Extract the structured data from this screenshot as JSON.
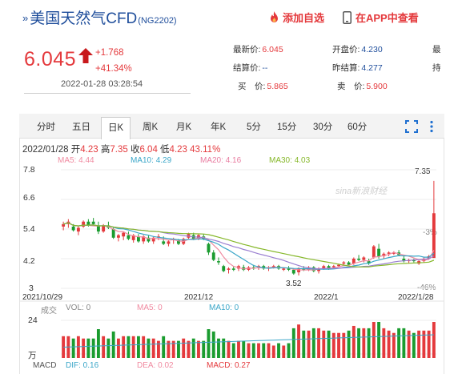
{
  "header": {
    "title": "美国天然气CFD",
    "code": "(NG2202)",
    "favorite_label": "添加自选",
    "app_label": "在APP中查看"
  },
  "quote": {
    "price": "6.045",
    "change": "+1.768",
    "change_pct": "+41.34%",
    "time": "2022-01-28 03:28:54",
    "fields": [
      {
        "label": "最新价:",
        "value": "6.045"
      },
      {
        "label": "结算价:",
        "value": "--"
      },
      {
        "label": "买　价:",
        "value": "5.865"
      },
      {
        "label": "开盘价:",
        "value": "4.230"
      },
      {
        "label": "昨结算:",
        "value": "4.277"
      },
      {
        "label": "卖　价:",
        "value": "5.900"
      },
      {
        "label": "最",
        "value": ""
      },
      {
        "label": "持",
        "value": ""
      }
    ]
  },
  "tabs": [
    "分时",
    "五日",
    "日K",
    "周K",
    "月K",
    "年K",
    "5分",
    "15分",
    "30分",
    "60分"
  ],
  "active_tab": "日K",
  "ohlc_line": {
    "date": "2022/01/28",
    "open_label": "开",
    "open": "4.23",
    "high_label": "高",
    "high": "7.35",
    "close_label": "收",
    "close": "6.04",
    "low_label": "低",
    "low": "4.23",
    "pct": "43.11%"
  },
  "ma_legend": [
    {
      "label": "MA5:",
      "value": "4.44",
      "color": "#f08aa0"
    },
    {
      "label": "MA10:",
      "value": "4.29",
      "color": "#3aa6c8"
    },
    {
      "label": "MA20:",
      "value": "4.16",
      "color": "#e87ca0"
    },
    {
      "label": "MA30:",
      "value": "4.03",
      "color": "#86b82a"
    }
  ],
  "watermark": "sina新浪财经",
  "chart_data": {
    "type": "candlestick",
    "y_ticks": [
      "7.8",
      "6.6",
      "5.4",
      "4.2",
      "3"
    ],
    "right_ticks": [
      "7.35",
      "-3%",
      "-46%"
    ],
    "x_labels": [
      "2021/10/29",
      "2021/12",
      "2022/1",
      "2022/1/28"
    ],
    "high_annotation": "7.35",
    "low_annotation": "3.52",
    "ylim": [
      3,
      7.8
    ],
    "candles": [
      [
        5.5,
        5.7,
        5.35,
        5.6
      ],
      [
        5.6,
        5.8,
        5.45,
        5.7
      ],
      [
        5.5,
        5.6,
        5.3,
        5.35
      ],
      [
        5.3,
        5.5,
        5.15,
        5.45
      ],
      [
        5.5,
        5.75,
        5.45,
        5.7
      ],
      [
        5.7,
        5.8,
        5.5,
        5.55
      ],
      [
        5.7,
        5.85,
        5.55,
        5.6
      ],
      [
        5.55,
        5.7,
        5.2,
        5.3
      ],
      [
        5.3,
        5.6,
        5.25,
        5.55
      ],
      [
        5.55,
        5.7,
        5.4,
        5.45
      ],
      [
        5.4,
        5.45,
        5.0,
        5.05
      ],
      [
        5.05,
        5.2,
        4.9,
        5.15
      ],
      [
        5.1,
        5.3,
        4.95,
        5.25
      ],
      [
        5.15,
        5.3,
        4.95,
        5.0
      ],
      [
        4.95,
        5.2,
        4.85,
        5.15
      ],
      [
        5.1,
        5.2,
        4.85,
        4.9
      ],
      [
        4.9,
        5.15,
        4.8,
        5.1
      ],
      [
        5.05,
        5.15,
        4.85,
        4.9
      ],
      [
        4.9,
        5.1,
        4.8,
        5.05
      ],
      [
        5.05,
        5.2,
        4.95,
        5.1
      ],
      [
        4.9,
        5.1,
        4.75,
        4.8
      ],
      [
        4.8,
        4.95,
        4.7,
        4.9
      ],
      [
        4.95,
        5.05,
        4.8,
        5.0
      ],
      [
        4.95,
        5.0,
        4.75,
        4.8
      ],
      [
        4.8,
        5.05,
        4.75,
        5.0
      ],
      [
        5.05,
        5.25,
        5.0,
        5.2
      ],
      [
        5.15,
        5.25,
        4.95,
        5.0
      ],
      [
        5.0,
        5.2,
        4.95,
        5.15
      ],
      [
        5.1,
        5.2,
        4.95,
        5.0
      ],
      [
        4.8,
        4.85,
        4.35,
        4.45
      ],
      [
        4.45,
        4.55,
        4.1,
        4.15
      ],
      [
        4.1,
        4.25,
        3.95,
        4.05
      ],
      [
        3.9,
        3.95,
        3.65,
        3.7
      ],
      [
        3.75,
        3.85,
        3.6,
        3.8
      ],
      [
        3.8,
        3.9,
        3.7,
        3.75
      ],
      [
        3.8,
        3.95,
        3.7,
        3.9
      ],
      [
        3.85,
        3.95,
        3.7,
        3.75
      ],
      [
        3.75,
        3.9,
        3.7,
        3.85
      ],
      [
        3.85,
        3.95,
        3.75,
        3.8
      ],
      [
        3.85,
        3.95,
        3.75,
        3.9
      ],
      [
        3.9,
        3.95,
        3.75,
        3.8
      ],
      [
        3.8,
        3.9,
        3.7,
        3.85
      ],
      [
        3.85,
        3.95,
        3.8,
        3.9
      ],
      [
        3.9,
        3.95,
        3.75,
        3.8
      ],
      [
        3.75,
        3.85,
        3.7,
        3.8
      ],
      [
        3.8,
        3.9,
        3.7,
        3.75
      ],
      [
        3.75,
        3.8,
        3.55,
        3.6
      ],
      [
        3.65,
        3.85,
        3.52,
        3.8
      ],
      [
        3.8,
        3.9,
        3.7,
        3.75
      ],
      [
        3.75,
        3.9,
        3.7,
        3.85
      ],
      [
        3.85,
        3.9,
        3.65,
        3.7
      ],
      [
        3.7,
        3.85,
        3.6,
        3.8
      ],
      [
        3.8,
        3.95,
        3.75,
        3.9
      ],
      [
        3.9,
        3.95,
        3.75,
        3.8
      ],
      [
        3.85,
        3.95,
        3.8,
        3.9
      ],
      [
        3.9,
        4.0,
        3.85,
        3.95
      ],
      [
        4.0,
        4.1,
        3.95,
        4.05
      ],
      [
        4.05,
        4.1,
        3.9,
        3.95
      ],
      [
        4.0,
        4.25,
        3.95,
        4.2
      ],
      [
        4.2,
        4.35,
        4.1,
        4.15
      ],
      [
        4.15,
        4.3,
        4.05,
        4.25
      ],
      [
        4.1,
        4.2,
        3.95,
        4.0
      ],
      [
        4.25,
        4.75,
        4.2,
        4.7
      ],
      [
        4.6,
        4.8,
        4.2,
        4.3
      ],
      [
        4.3,
        4.45,
        4.2,
        4.4
      ],
      [
        4.4,
        4.5,
        4.3,
        4.45
      ],
      [
        4.4,
        4.5,
        4.35,
        4.45
      ],
      [
        4.45,
        4.55,
        4.3,
        4.35
      ],
      [
        4.2,
        4.3,
        4.05,
        4.1
      ],
      [
        4.1,
        4.2,
        4.0,
        4.15
      ],
      [
        4.15,
        4.2,
        4.05,
        4.1
      ],
      [
        4.0,
        4.15,
        3.95,
        4.1
      ],
      [
        4.1,
        4.25,
        4.05,
        4.2
      ],
      [
        4.2,
        4.35,
        4.15,
        4.3
      ],
      [
        4.23,
        7.35,
        4.23,
        6.04
      ]
    ],
    "volume": {
      "title": "成交",
      "vol_label": "VOL: 0",
      "ma5_label": "MA5: 0",
      "ma10_label": "MA10: 0",
      "y_ticks": [
        "24",
        "万"
      ]
    },
    "macd": {
      "label": "MACD",
      "dif": "DIF: 0.16",
      "dea": "DEA: 0.02",
      "macd": "MACD: 0.27"
    }
  }
}
